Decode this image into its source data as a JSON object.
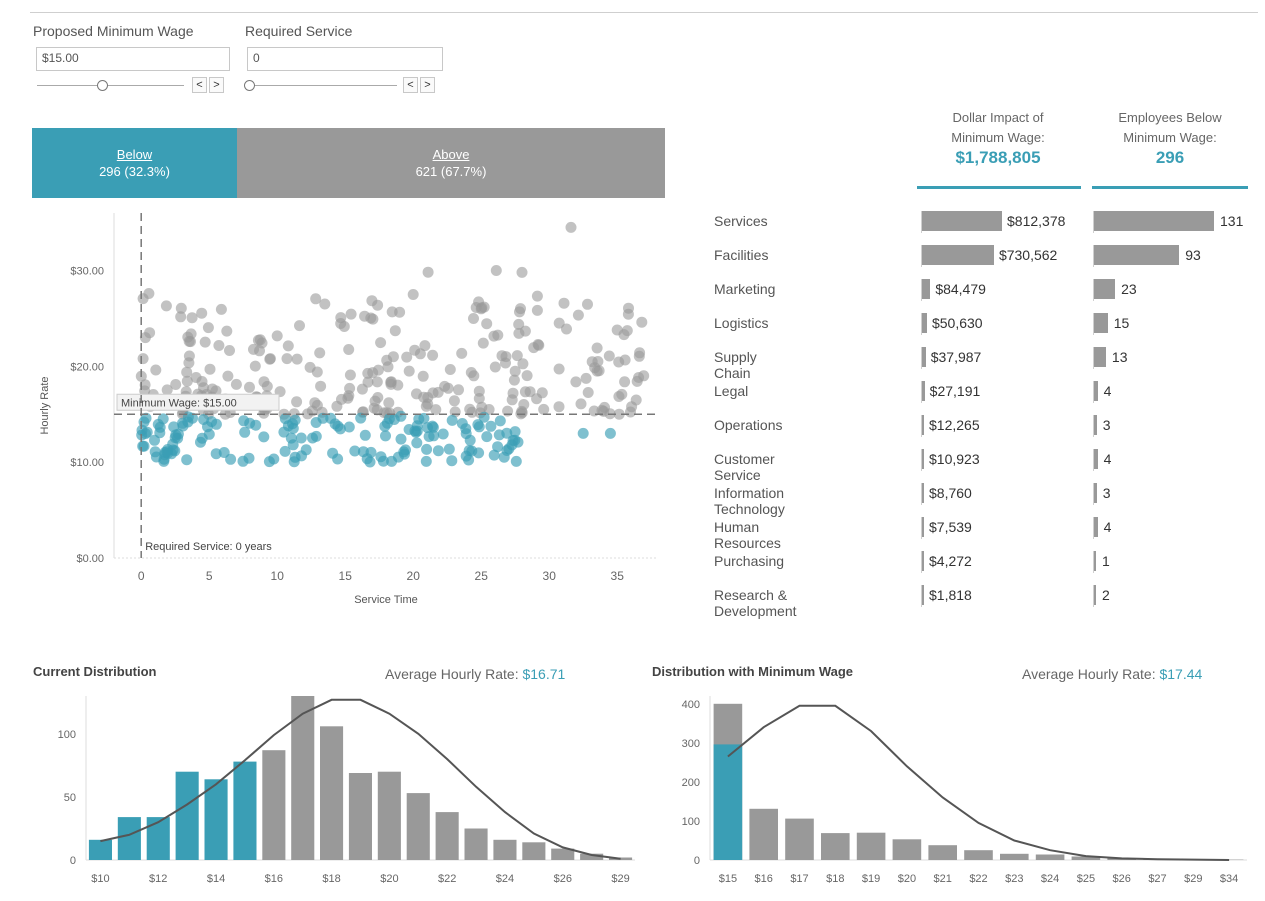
{
  "params": {
    "wage": {
      "label": "Proposed Minimum Wage",
      "value": "$15.00",
      "slider_fraction": 0.45
    },
    "service": {
      "label": "Required Service",
      "value": "0",
      "slider_fraction": 0.0
    },
    "prev_glyph": "<",
    "next_glyph": ">"
  },
  "split": {
    "below_label": "Below",
    "below_value": "296 (32.3%)",
    "above_label": "Above",
    "above_value": "621 (67.7%)",
    "below_color": "#3a9eb5",
    "above_color": "#999999"
  },
  "kpis": {
    "impact_title_1": "Dollar Impact of",
    "impact_title_2": "Minimum Wage:",
    "impact_value": "$1,788,805",
    "employees_title_1": "Employees Below",
    "employees_title_2": "Minimum Wage:",
    "employees_value": "296"
  },
  "departments": [
    {
      "name": "Services",
      "impact_label": "$812,378",
      "impact": 812378,
      "employees": 131
    },
    {
      "name": "Facilities",
      "impact_label": "$730,562",
      "impact": 730562,
      "employees": 93
    },
    {
      "name": "Marketing",
      "impact_label": "$84,479",
      "impact": 84479,
      "employees": 23
    },
    {
      "name": "Logistics",
      "impact_label": "$50,630",
      "impact": 50630,
      "employees": 15
    },
    {
      "name": "Supply Chain",
      "impact_label": "$37,987",
      "impact": 37987,
      "employees": 13
    },
    {
      "name": "Legal",
      "impact_label": "$27,191",
      "impact": 27191,
      "employees": 4
    },
    {
      "name": "Operations",
      "impact_label": "$12,265",
      "impact": 12265,
      "employees": 3
    },
    {
      "name": "Customer Service",
      "impact_label": "$10,923",
      "impact": 10923,
      "employees": 4
    },
    {
      "name": "Information Technology",
      "impact_label": "$8,760",
      "impact": 8760,
      "employees": 3
    },
    {
      "name": "Human Resources",
      "impact_label": "$7,539",
      "impact": 7539,
      "employees": 4
    },
    {
      "name": "Purchasing",
      "impact_label": "$4,272",
      "impact": 4272,
      "employees": 1
    },
    {
      "name": "Research & Development",
      "impact_label": "$1,818",
      "impact": 1818,
      "employees": 2
    }
  ],
  "hist_current": {
    "title": "Current Distribution",
    "avg_label": "Average Hourly Rate:",
    "avg_value": "$16.71"
  },
  "hist_min": {
    "title": "Distribution with Minimum Wage",
    "avg_label": "Average Hourly Rate:",
    "avg_value": "$17.44"
  },
  "chart_data": [
    {
      "type": "scatter",
      "xlabel": "Service Time",
      "ylabel": "Hourly Rate",
      "xlim": [
        -2,
        38
      ],
      "ylim": [
        0,
        36
      ],
      "xticks": [
        "0",
        "5",
        "10",
        "15",
        "20",
        "25",
        "30",
        "35"
      ],
      "yticks": [
        "$0.00",
        "$10.00",
        "$20.00",
        "$30.00"
      ],
      "reference_lines": {
        "min_wage": 15,
        "min_wage_label": "Minimum Wage: $15.00",
        "required_service": 0,
        "required_service_label": "Required Service: 0 years"
      },
      "colors": {
        "below": "#3a9eb5",
        "above": "#999999"
      },
      "series": [
        {
          "name": "Below",
          "count": 296,
          "x_range": [
            0,
            33
          ],
          "y_range": [
            10,
            15
          ]
        },
        {
          "name": "Above",
          "count": 621,
          "x_range": [
            0,
            37
          ],
          "y_range": [
            15,
            34.5
          ]
        }
      ]
    },
    {
      "type": "bar",
      "categories": [
        "$10",
        "$11",
        "$12",
        "$13",
        "$14",
        "$15",
        "$16",
        "$17",
        "$18",
        "$19",
        "$20",
        "$21",
        "$22",
        "$23",
        "$24",
        "$25",
        "$26",
        "$27",
        "$29"
      ],
      "shown_tick_labels": [
        "$10",
        "$12",
        "$14",
        "$16",
        "$18",
        "$20",
        "$22",
        "$24",
        "$26",
        "$29"
      ],
      "values": [
        16,
        34,
        34,
        70,
        64,
        78,
        87,
        130,
        106,
        69,
        70,
        53,
        38,
        25,
        16,
        14,
        9,
        5,
        2
      ],
      "below_min_wage_count": 6,
      "curve": [
        15,
        20,
        30,
        44,
        60,
        79,
        99,
        116,
        127,
        127,
        116,
        100,
        80,
        58,
        38,
        21,
        10,
        4,
        1
      ],
      "ylim": [
        0,
        130
      ],
      "yticks": [
        "0",
        "50",
        "100"
      ]
    },
    {
      "type": "bar",
      "categories": [
        "$15",
        "$16",
        "$17",
        "$18",
        "$19",
        "$20",
        "$21",
        "$22",
        "$23",
        "$24",
        "$25",
        "$26",
        "$27",
        "$29",
        "$34"
      ],
      "values": [
        400,
        131,
        106,
        69,
        70,
        53,
        38,
        25,
        16,
        14,
        9,
        5,
        2,
        1,
        1
      ],
      "below_portion": [
        296,
        0,
        0,
        0,
        0,
        0,
        0,
        0,
        0,
        0,
        0,
        0,
        0,
        0,
        0
      ],
      "curve": [
        265,
        340,
        395,
        395,
        330,
        240,
        160,
        95,
        50,
        25,
        10,
        4,
        2,
        1,
        0
      ],
      "ylim": [
        0,
        420
      ],
      "yticks": [
        "0",
        "100",
        "200",
        "300",
        "400"
      ]
    }
  ]
}
